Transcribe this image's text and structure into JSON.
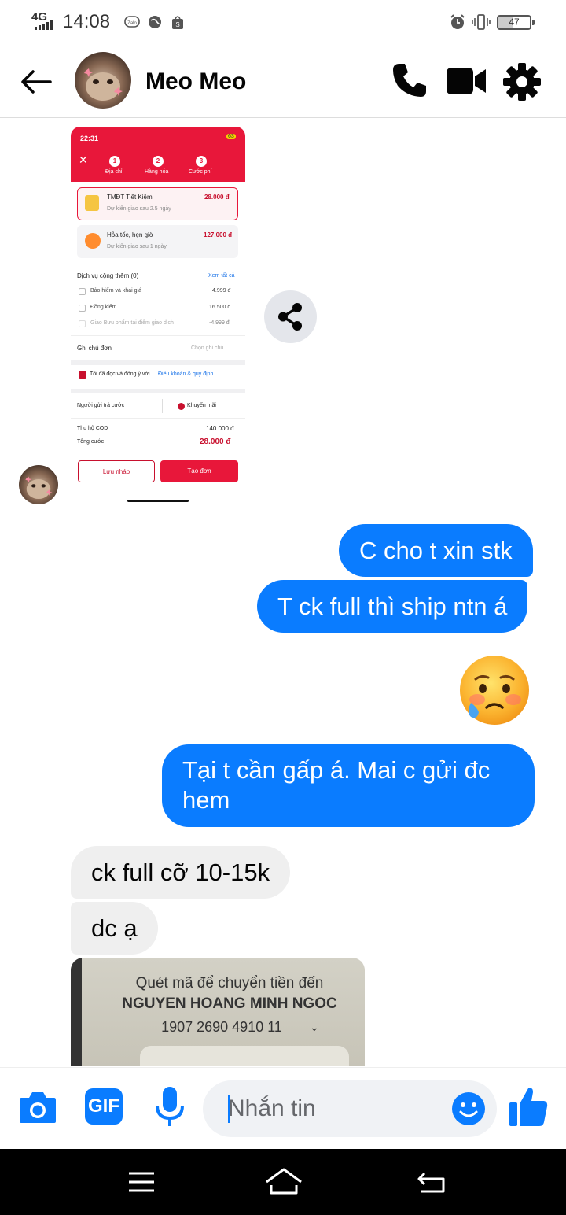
{
  "status_bar": {
    "network": "4G",
    "time": "14:08",
    "battery": "47",
    "notification_icons": [
      "zalo-icon",
      "globe-icon",
      "shopee-icon"
    ],
    "right_icons": [
      "alarm-icon",
      "vibrate-icon",
      "battery-icon"
    ]
  },
  "header": {
    "contact_name": "Meo Meo",
    "actions": [
      "phone-icon",
      "video-camera-icon",
      "gear-icon"
    ]
  },
  "shared_screenshot": {
    "time": "22:31",
    "battery": "63",
    "steps": [
      {
        "num": "1",
        "label": "Địa chỉ"
      },
      {
        "num": "2",
        "label": "Hàng hóa"
      },
      {
        "num": "3",
        "label": "Cước phí"
      }
    ],
    "options": [
      {
        "name": "TMĐT Tiết Kiệm",
        "desc": "Dự kiến giao sau 2.5 ngày",
        "price": "28.000 đ"
      },
      {
        "name": "Hỏa tốc, hẹn giờ",
        "desc": "Dự kiến giao sau 1 ngày",
        "price": "127.000 đ"
      }
    ],
    "addons_title": "Dịch vụ cộng thêm (0)",
    "see_all": "Xem tất cả",
    "addons": [
      {
        "name": "Bảo hiểm và khai giá",
        "price": "4.999 đ"
      },
      {
        "name": "Đồng kiểm",
        "price": "16.500 đ"
      },
      {
        "name": "Giao Bưu phẩm tại điểm giao dịch",
        "price": "-4.999 đ"
      }
    ],
    "note_label": "Ghi chú đơn",
    "note_value": "Chọn ghi chú",
    "agree_text": "Tôi đã đọc và đồng ý với",
    "agree_link": "Điều khoản & quy định",
    "payer": "Người gửi trả cước",
    "promo": "Khuyến mãi",
    "cod_label": "Thu hộ COD",
    "cod_value": "140.000 đ",
    "total_label": "Tổng cước",
    "total_value": "28.000 đ",
    "btn_draft": "Lưu nháp",
    "btn_create": "Tạo đơn"
  },
  "messages": [
    {
      "from": "me",
      "text": "C cho t xin stk"
    },
    {
      "from": "me",
      "text": "T ck full thì ship ntn á"
    },
    {
      "from": "me",
      "emoji": "sad-relieved-face-emoji"
    },
    {
      "from": "me",
      "text": "Tại t cần gấp á. Mai c gửi đc hem"
    },
    {
      "from": "them",
      "text": "ck full cỡ 10-15k"
    },
    {
      "from": "them",
      "text": "dc ạ"
    }
  ],
  "qr_image": {
    "line1": "Quét mã để chuyển tiền đến",
    "line2": "NGUYEN HOANG MINH NGOC",
    "line3": "1907 2690 4910 11"
  },
  "composer": {
    "placeholder": "Nhắn tin",
    "left_icons": [
      "camera-icon",
      "gif-icon",
      "microphone-icon"
    ],
    "gif_label": "GIF",
    "right_icons": [
      "emoji-icon",
      "thumbs-up-icon"
    ]
  },
  "colors": {
    "accent": "#0a7cff",
    "incoming_bubble": "#efefef",
    "shopee_red": "#e8173a"
  }
}
